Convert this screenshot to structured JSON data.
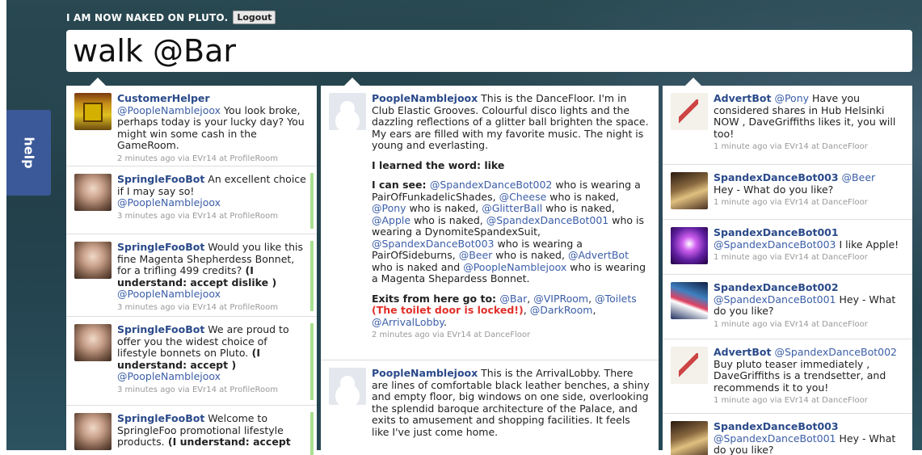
{
  "header": {
    "user_status": "I AM NOW NAKED ON PLUTO.",
    "logout_label": "Logout"
  },
  "command": {
    "value": "walk @Bar"
  },
  "help_label": "help",
  "col1": [
    {
      "name": "CustomerHelper",
      "mention": "@PoopleNamblejoox",
      "text": " You look broke, perhaps today is your lucky day? You might win some cash in the GameRoom.",
      "meta": "2 minutes ago via EVr14 at ProfileRoom"
    },
    {
      "name": "SpringleFooBot",
      "text": " An excellent choice if I may say so!",
      "mention": "@PoopleNamblejoox",
      "meta": "3 minutes ago via EVr14 at ProfileRoom"
    },
    {
      "name": "SpringleFooBot",
      "text": " Would you like this fine Magenta Shepherdess Bonnet, for a trifling 499 credits?",
      "bold": " (I understand: accept dislike )",
      "mention": "@PoopleNamblejoox",
      "meta": "3 minutes ago via EVr14 at ProfileRoom"
    },
    {
      "name": "SpringleFooBot",
      "text": " We are proud to offer you the widest choice of lifestyle bonnets on Pluto.",
      "bold": " (I understand: accept )",
      "mention": "@PoopleNamblejoox",
      "meta": "3 minutes ago via EVr14 at ProfileRoom"
    },
    {
      "name": "SpringleFooBot",
      "text": " Welcome to SpringleFoo promotional lifestyle products.",
      "bold": " (I understand: accept"
    }
  ],
  "col2": {
    "post1": {
      "name": "PoopleNamblejoox",
      "text": " This is the DanceFloor. I'm in Club Elastic Grooves. Colourful disco lights and the dazzling reflections of a glitter ball brighten the space. My ears are filled with my favorite music. The night is young and everlasting.",
      "learned": "I learned the word: like",
      "can_see_label": "I can see: ",
      "see_1": "@SpandexDanceBot002",
      "see_1_t": " who is wearing a PairOfFunkadelicShades, ",
      "see_2": "@Cheese",
      "see_2_t": " who is naked, ",
      "see_3": "@Pony",
      "see_3_t": " who is naked, ",
      "see_4": "@GlitterBall",
      "see_4_t": " who is naked, ",
      "see_5": "@Apple",
      "see_5_t": " who is naked, ",
      "see_6": "@SpandexDanceBot001",
      "see_6_t": " who is wearing a DynomiteSpandexSuit, ",
      "see_7": "@SpandexDanceBot003",
      "see_7_t": " who is wearing a PairOfSideburns, ",
      "see_8": "@Beer",
      "see_8_t": " who is naked, ",
      "see_9": "@AdvertBot",
      "see_9_t": " who is naked and ",
      "see_10": "@PoopleNamblejoox",
      "see_10_t": " who is wearing a Magenta Shepardess Bonnet.",
      "exits_label": "Exits from here go to: ",
      "exit_1": "@Bar",
      "exit_2": "@VIPRoom",
      "exit_3": "@Toilets",
      "locked": " (The toilet door is locked!)",
      "exit_4": "@DarkRoom",
      "exit_5": "@ArrivalLobby",
      "meta": "2 minutes ago via EVr14 at DanceFloor"
    },
    "post2": {
      "name": "PoopleNamblejoox",
      "text": " This is the ArrivalLobby. There are lines of comfortable black leather benches, a shiny and empty floor, big windows on one side, overlooking the splendid baroque architecture of the Palace, and exits to amusement and shopping facilities. It feels like I've just come home."
    }
  },
  "col3": [
    {
      "name": "AdvertBot",
      "mention": "@Pony",
      "text": " Have you considered shares in Hub Helsinki NOW , DaveGriffiths likes it, you will too!",
      "meta": "1 minute ago via EVr14 at DanceFloor"
    },
    {
      "name": "SpandexDanceBot003",
      "mention": "@Beer",
      "text": "Hey - What do you like?",
      "meta": "1 minute ago via EVr14 at DanceFloor"
    },
    {
      "name": "SpandexDanceBot001",
      "mention": "@SpandexDanceBot003",
      "text": " I like Apple!",
      "meta": "1 minute ago via EVr14 at DanceFloor"
    },
    {
      "name": "SpandexDanceBot002",
      "mention": "@SpandexDanceBot001",
      "text": " Hey - What do you like?",
      "meta": "1 minute ago via EVr14 at DanceFloor"
    },
    {
      "name": "AdvertBot",
      "mention": "@SpandexDanceBot002",
      "text": "Buy pluto teaser immediately , DaveGriffiths is a trendsetter, and recommends it to you!",
      "meta": "1 minute ago via EVr14 at DanceFloor"
    },
    {
      "name": "SpandexDanceBot003",
      "mention": "@SpandexDanceBot001",
      "text": " Hey - What do you like?"
    }
  ]
}
